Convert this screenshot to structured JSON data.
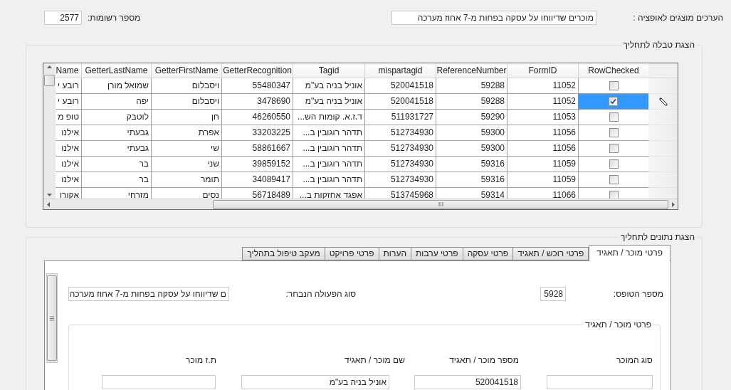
{
  "header": {
    "option_label": "הערכים מוצגים לאופציה :",
    "option_value": "מוכרים שדיווחו על עסקה בפחות מ-7 אחוז מערכה",
    "records_label": "מספר רשומות:",
    "records_value": "2577"
  },
  "table_group": {
    "title": "הצגת טבלה לתחליך",
    "check_column": "RowChecked",
    "columns": [
      "FormID",
      "ReferenceNumber",
      "mispartagid",
      "Tagid",
      "GetterRecognition",
      "GetterFirstName",
      "GetterLastName",
      "Name"
    ],
    "rows": [
      {
        "checked": false,
        "selected": false,
        "cells": [
          "11052",
          "59288",
          "520041518",
          "אוניל בניה בע\"מ",
          "55480347",
          "ויסבלום",
          "שמואל מורן",
          "רובע י"
        ]
      },
      {
        "checked": true,
        "selected": true,
        "cells": [
          "11052",
          "59288",
          "520041518",
          "אוניל בניה בע\"מ",
          "3478690",
          "ויסבלום",
          "יפה",
          "רובע י"
        ]
      },
      {
        "checked": false,
        "selected": false,
        "cells": [
          "11053",
          "59290",
          "511931727",
          "ד.ז.א. קומות הש...",
          "46260550",
          "חן",
          "לוטבק",
          "טופ מ"
        ]
      },
      {
        "checked": false,
        "selected": false,
        "cells": [
          "11056",
          "59300",
          "512734930",
          "תדהר רוגובין ב...",
          "33203225",
          "אפרת",
          "גבעתי",
          "אילנו"
        ]
      },
      {
        "checked": false,
        "selected": false,
        "cells": [
          "11056",
          "59300",
          "512734930",
          "תדהר רוגובין ב...",
          "58861667",
          "שי",
          "גבעתי",
          "אילנו"
        ]
      },
      {
        "checked": false,
        "selected": false,
        "cells": [
          "11059",
          "59316",
          "512734930",
          "תדהר רוגובין ב...",
          "39859152",
          "שני",
          "בר",
          "אילנו"
        ]
      },
      {
        "checked": false,
        "selected": false,
        "cells": [
          "11059",
          "59316",
          "512734930",
          "תדהר רוגובין ב...",
          "34089417",
          "תומר",
          "בר",
          "אילנו"
        ]
      },
      {
        "checked": false,
        "selected": false,
        "cells": [
          "11066",
          "59314",
          "513745968",
          "אפגד אחזקות ב...",
          "56718489",
          "נסים",
          "מזרחי",
          "אקורו"
        ]
      }
    ]
  },
  "details_group": {
    "title": "הצגת נתונים לתחליך",
    "tabs": [
      {
        "label": "פרטי מוכר / תאגיד",
        "selected": true
      },
      {
        "label": "פרטי רוכש / תאגיד",
        "selected": false
      },
      {
        "label": "פרטי עסקה",
        "selected": false
      },
      {
        "label": "פרטי ערבות",
        "selected": false
      },
      {
        "label": "הערות",
        "selected": false
      },
      {
        "label": "פרטי פרויקט",
        "selected": false
      },
      {
        "label": "מעקב טיפול בתהליך",
        "selected": false
      }
    ],
    "form_number_label": "מספר הטופס:",
    "form_number": "5928",
    "action_type_label": "סוג הפעולה הנבחר:",
    "action_type_value": "ם שדיווחו על עסקה בפחות מ-7 אחוז מערכה",
    "seller_group": {
      "title": "פרטי מוכר / תאגיד",
      "fields": [
        {
          "label": "סוג המוכר"
        },
        {
          "label": "מספר מוכר / תאגיד",
          "value": "520041518"
        },
        {
          "label": "שם מוכר / תאגיד",
          "value": "אוניל בניה בע\"מ"
        },
        {
          "label": "ת.ז מוכר"
        }
      ]
    }
  }
}
